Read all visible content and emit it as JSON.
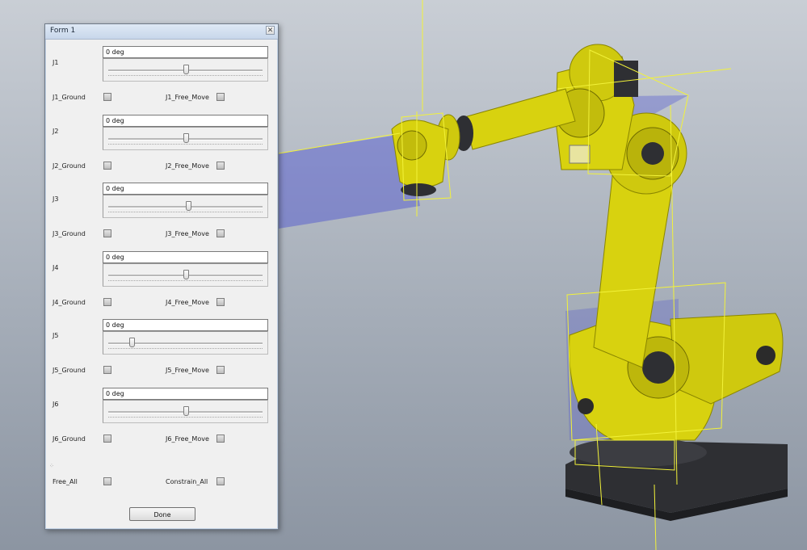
{
  "window": {
    "title": "Form 1",
    "close_glyph": "✕"
  },
  "joints": [
    {
      "label": "J1",
      "value": "0 deg",
      "slider_fraction": 0.5,
      "ground_label": "J1_Ground",
      "free_label": "J1_Free_Move"
    },
    {
      "label": "J2",
      "value": "0 deg",
      "slider_fraction": 0.5,
      "ground_label": "J2_Ground",
      "free_label": "J2_Free_Move"
    },
    {
      "label": "J3",
      "value": "0 deg",
      "slider_fraction": 0.52,
      "ground_label": "J3_Ground",
      "free_label": "J3_Free_Move"
    },
    {
      "label": "J4",
      "value": "0 deg",
      "slider_fraction": 0.5,
      "ground_label": "J4_Ground",
      "free_label": "J4_Free_Move"
    },
    {
      "label": "J5",
      "value": "0 deg",
      "slider_fraction": 0.15,
      "ground_label": "J5_Ground",
      "free_label": "J5_Free_Move"
    },
    {
      "label": "J6",
      "value": "0 deg",
      "slider_fraction": 0.5,
      "ground_label": "J6_Ground",
      "free_label": "J6_Free_Move"
    }
  ],
  "bottom": {
    "free_all_label": "Free_All",
    "constrain_all_label": "Constrain_All",
    "done_label": "Done",
    "grip_glyph": "⁘"
  },
  "viewport": {
    "model": "robot-arm",
    "body_color": "#d8d20f",
    "base_color": "#2e2f33",
    "plane_color": "#4a4fd0",
    "work_line_color": "#f2f23a"
  }
}
